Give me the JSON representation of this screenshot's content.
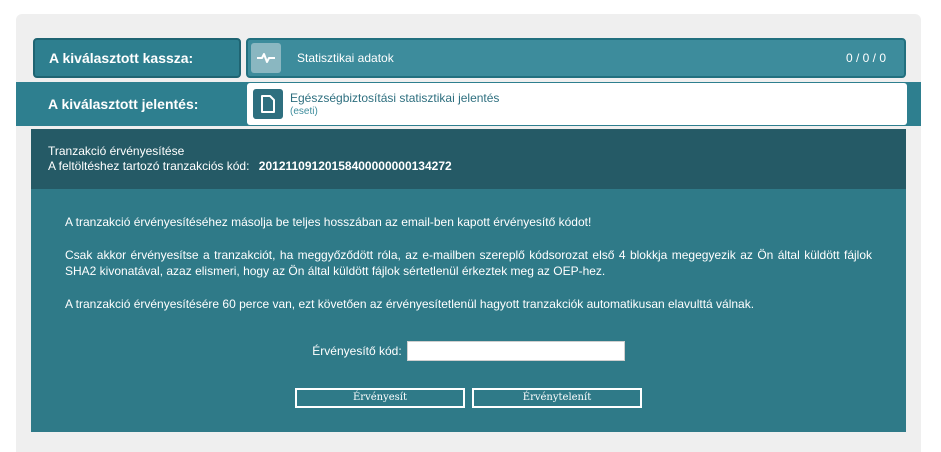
{
  "kassza": {
    "label": "A kiválasztott kassza:",
    "name": "Statisztikai adatok",
    "count": "0 / 0 / 0",
    "icon": "pulse-icon"
  },
  "jelentes": {
    "label": "A kiválasztott jelentés:",
    "title": "Egészségbiztosítási statisztikai jelentés",
    "subtitle": "(eseti)",
    "icon": "document-icon"
  },
  "transaction": {
    "heading": "Tranzakció érvényesítése",
    "code_label": "A feltöltéshez tartozó tranzakciós kód:",
    "code": "20121109120158400000000134272"
  },
  "instructions": {
    "p1": "A tranzakció érvényesítéséhez másolja be teljes hosszában az email-ben kapott érvényesítő kódot!",
    "p2": "Csak akkor érvényesítse a tranzakciót, ha meggyőződött róla, az e-mailben szereplő kódsorozat első 4 blokkja megegyezik az Ön által küldött fájlok SHA2 kivonatával, azaz elismeri, hogy az Ön által küldött fájlok sértetlenül érkeztek meg az OEP-hez.",
    "p3": "A tranzakció érvényesítésére 60 perce van, ezt követően az érvényesítetlenül hagyott tranzakciók automatikusan elavulttá válnak."
  },
  "form": {
    "code_label": "Érvényesítő kód:",
    "code_value": "",
    "validate_button": "Érvényesít",
    "invalidate_button": "Érvénytelenít"
  },
  "colors": {
    "primary": "#2e7f8f",
    "header_dark": "#255a66",
    "body_teal": "#2f7a88",
    "panel_bg": "#efefef"
  }
}
